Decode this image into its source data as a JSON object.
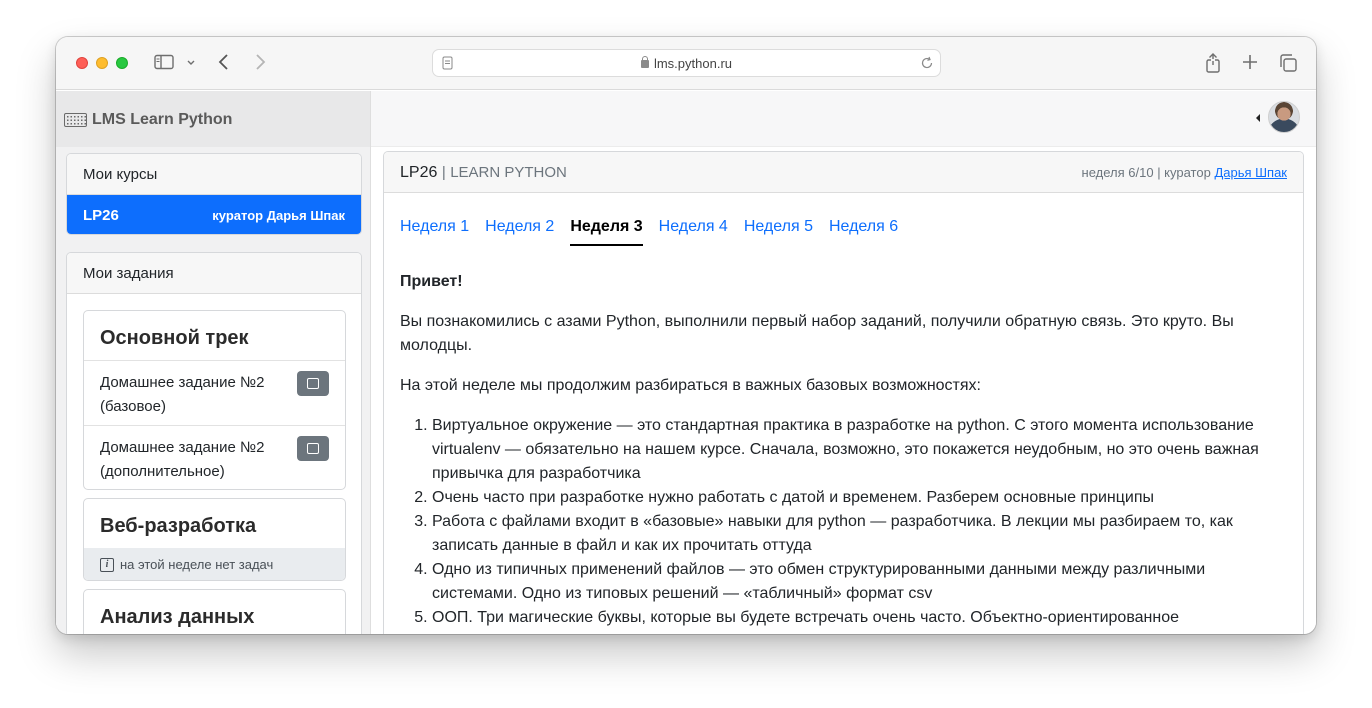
{
  "browser": {
    "url": "lms.python.ru"
  },
  "brand": {
    "title": "LMS Learn Python"
  },
  "sidebar": {
    "courses_header": "Мои курсы",
    "active_course": {
      "code": "LP26",
      "curator": "куратор Дарья Шпак"
    },
    "tasks_header": "Мои задания",
    "tracks": [
      {
        "title": "Основной трек",
        "tasks": [
          "Домашнее задание №2 (базовое)",
          "Домашнее задание №2 (дополнительное)"
        ]
      },
      {
        "title": "Веб-разработка",
        "note": "на этой неделе нет задач"
      },
      {
        "title": "Анализ данных"
      }
    ]
  },
  "main": {
    "code": "LP26",
    "separator": "|",
    "course_name": "LEARN PYTHON",
    "week_info": "неделя 6/10 | куратор",
    "curator_link": "Дарья Шпак",
    "tabs": [
      "Неделя 1",
      "Неделя 2",
      "Неделя 3",
      "Неделя 4",
      "Неделя 5",
      "Неделя 6"
    ],
    "active_tab": 2,
    "greeting": "Привет!",
    "intro": "Вы познакомились с азами Python, выполнили первый набор заданий, получили обратную связь. Это круто. Вы молодцы.",
    "lead": "На этой неделе мы продолжим разбираться в важных базовых возможностях:",
    "items": [
      "Виртуальное окружение — это стандартная практика в разработке на python. С этого момента использование virtualenv — обязательно на нашем курсе. Сначала, возможно, это покажется неудобным, но это очень важная привычка для разработчика",
      "Очень часто при разработке нужно работать с датой и временем. Разберем основные принципы",
      "Работа с файлами входит в «базовые» навыки для python — разработчика. В лекции мы разбираем то, как записать данные в файл и как их прочитать оттуда",
      "Одно из типичных применений файлов — это обмен структурированными данными между различными системами. Одно из типовых решений — «табличный» формат csv",
      "ООП. Три магические буквы, которые вы будете встречать очень часто. Объектно-ориентированное"
    ]
  },
  "colors": {
    "primary": "#0d6efd",
    "secondary_btn": "#6c757d"
  }
}
